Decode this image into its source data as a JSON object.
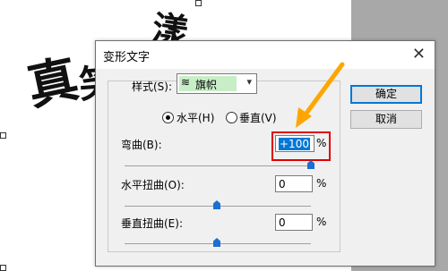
{
  "dialog": {
    "title": "变形文字",
    "style_label": "样式(S):",
    "style_value": "旗帜",
    "orientation": {
      "horizontal_label": "水平(H)",
      "vertical_label": "垂直(V)",
      "selected": "horizontal"
    },
    "bend": {
      "label": "弯曲(B):",
      "value": "+100",
      "unit": "%",
      "level": 1.0
    },
    "horizontal_distortion": {
      "label": "水平扭曲(O):",
      "value": "0",
      "unit": "%",
      "level": 0.5
    },
    "vertical_distortion": {
      "label": "垂直扭曲(E):",
      "value": "0",
      "unit": "%",
      "level": 0.5
    },
    "buttons": {
      "ok": "确定",
      "cancel": "取消"
    }
  },
  "background_text": {
    "left": "真",
    "mid": "笑",
    "top": "漾"
  },
  "colors": {
    "highlight": "#e00000",
    "arrow": "#ffa500",
    "slider": "#1a6fd0"
  }
}
